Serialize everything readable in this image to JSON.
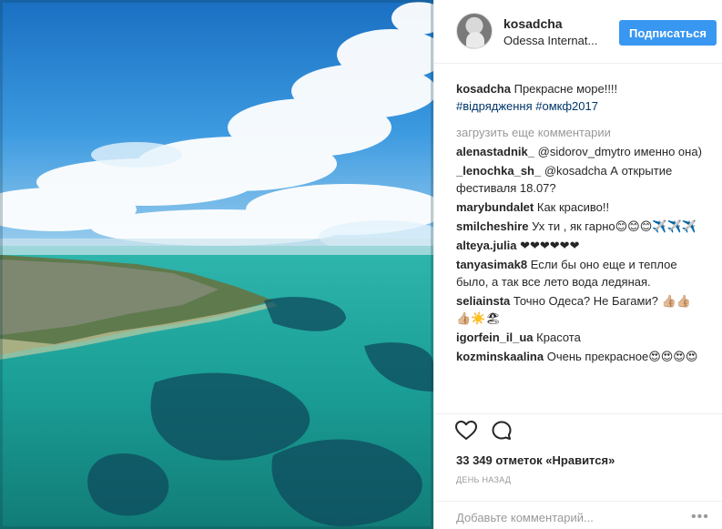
{
  "post": {
    "author": "kosadcha",
    "location": "Odessa Internat...",
    "follow_label": "Подписаться"
  },
  "caption": {
    "user": "kosadcha",
    "text": "Прекрасне море!!!!",
    "tags": "#відрядження #омкф2017"
  },
  "load_more": "загрузить еще комментарии",
  "comments": [
    {
      "user": "alenastadnik_",
      "text": "@sidorov_dmytro именно она)"
    },
    {
      "user": "_lenochka_sh_",
      "text": "@kosadcha А открытие фестиваля 18.07?"
    },
    {
      "user": "marybundalet",
      "text": "Как красиво!!"
    },
    {
      "user": "smilcheshire",
      "text": "Ух ти , як гарно😊😊😊✈️✈️✈️"
    },
    {
      "user": "alteya.julia",
      "text": "❤❤❤❤❤❤"
    },
    {
      "user": "tanyasimak8",
      "text": "Если бы оно еще и теплое было, а так все лето вода ледяная."
    },
    {
      "user": "seliainsta",
      "text": "Точно Одеса? Не Багами? 👍🏼👍🏼👍🏼☀️🏖"
    },
    {
      "user": "igorfein_il_ua",
      "text": "Красота"
    },
    {
      "user": "kozminskaalina",
      "text": "Очень прекрасное😍😍😍😍"
    }
  ],
  "likes": "33 349 отметок «Нравится»",
  "time_ago": "день назад",
  "add_comment_placeholder": "Добавьте комментарий...",
  "more_label": "•••",
  "icons": {
    "like": "heart-icon",
    "comment": "comment-icon",
    "more": "more-options-icon"
  },
  "colors": {
    "accent": "#3897f0",
    "text": "#262626",
    "muted": "#999999",
    "hashtag": "#003569"
  }
}
